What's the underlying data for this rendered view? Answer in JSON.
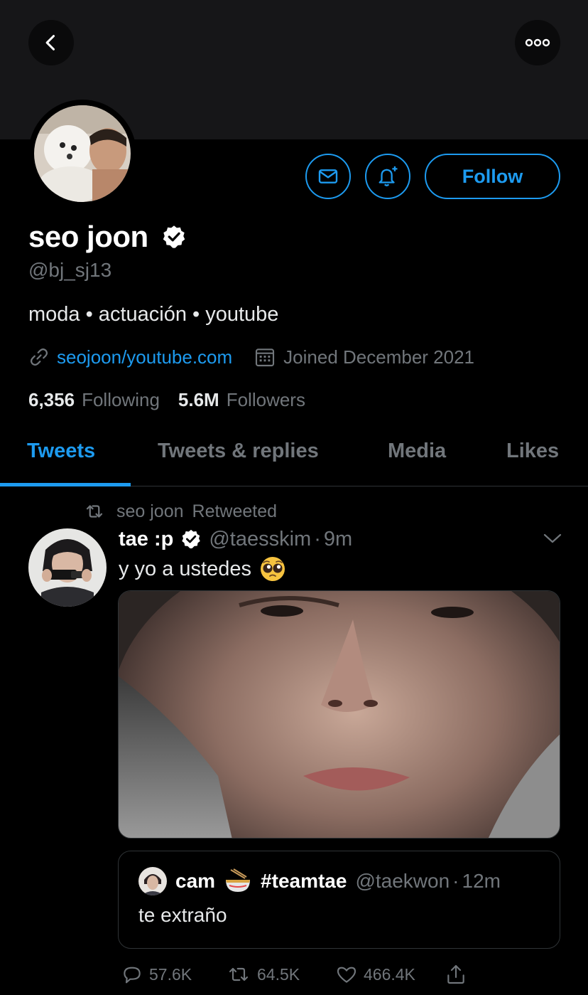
{
  "profile": {
    "display_name": "seo joon",
    "handle": "@bj_sj13",
    "bio": "moda • actuación • youtube",
    "website": "seojoon/youtube.com",
    "joined": "Joined December 2021",
    "following_count": "6,356",
    "following_label": "Following",
    "followers_count": "5.6M",
    "followers_label": "Followers",
    "follow_button": "Follow"
  },
  "tabs": [
    {
      "label": "Tweets",
      "active": true
    },
    {
      "label": "Tweets & replies",
      "active": false
    },
    {
      "label": "Media",
      "active": false
    },
    {
      "label": "Likes",
      "active": false
    }
  ],
  "tweet": {
    "retweeted_by": "seo joon",
    "retweeted_label": "Retweeted",
    "author_name": "tae :p",
    "author_handle": "@taesskim",
    "time_sep": "·",
    "time": "9m",
    "text": "y yo a ustedes",
    "text_emoji": "pleading-face-emoji",
    "quote": {
      "author_name": "cam",
      "name_emoji": "ramen-bowl-emoji",
      "hashtag": "#teamtae",
      "author_handle": "@taekwon",
      "time_sep": "·",
      "time": "12m",
      "text": "te extraño"
    },
    "actions": {
      "replies": "57.6K",
      "retweets": "64.5K",
      "likes": "466.4K"
    }
  },
  "colors": {
    "accent": "#1d9bf0",
    "background": "#000000",
    "secondary_text": "#71767b",
    "banner": "#161618"
  },
  "icons": [
    "back-arrow-icon",
    "more-options-icon",
    "mail-icon",
    "bell-plus-icon",
    "verified-badge-icon",
    "link-icon",
    "calendar-icon",
    "retweet-icon",
    "chevron-down-icon",
    "reply-icon",
    "like-icon",
    "share-icon"
  ]
}
